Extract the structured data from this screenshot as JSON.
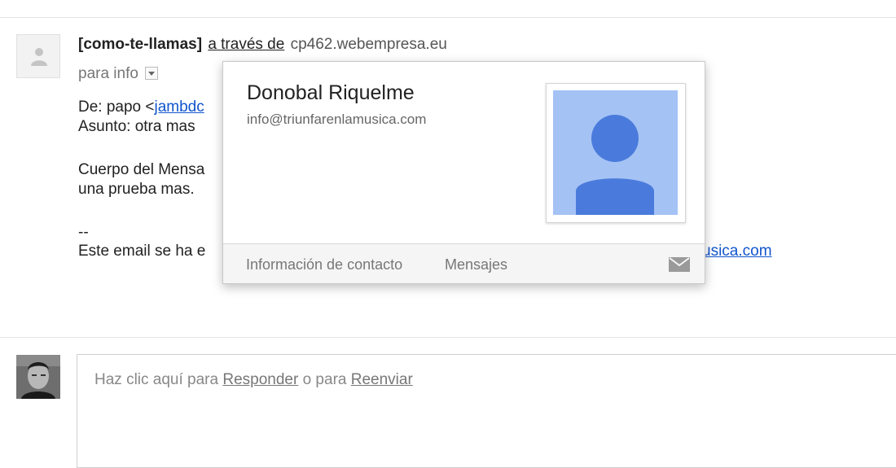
{
  "message": {
    "sender_name": "[como-te-llamas]",
    "via_label": "a través de",
    "via_domain": "cp462.webempresa.eu",
    "to_label": "para info",
    "from_line_prefix": "De: papo <",
    "from_link": "jambdc",
    "subject_line": "Asunto: otra mas",
    "body_line1": "Cuerpo del Mensa",
    "body_line2": "una prueba mas.",
    "signature_sep": "--",
    "footer_prefix": "Este email se ha e",
    "footer_link": "usica.com"
  },
  "contact_card": {
    "name": "Donobal Riquelme",
    "email": "info@triunfarenlamusica.com",
    "contact_info_link": "Información de contacto",
    "messages_link": "Mensajes",
    "photo_bg_color": "#a4c2f4",
    "photo_fg_color": "#4a7bdc"
  },
  "reply": {
    "prefix": "Haz clic aquí para ",
    "reply_link": "Responder",
    "middle": " o para ",
    "forward_link": "Reenviar"
  }
}
